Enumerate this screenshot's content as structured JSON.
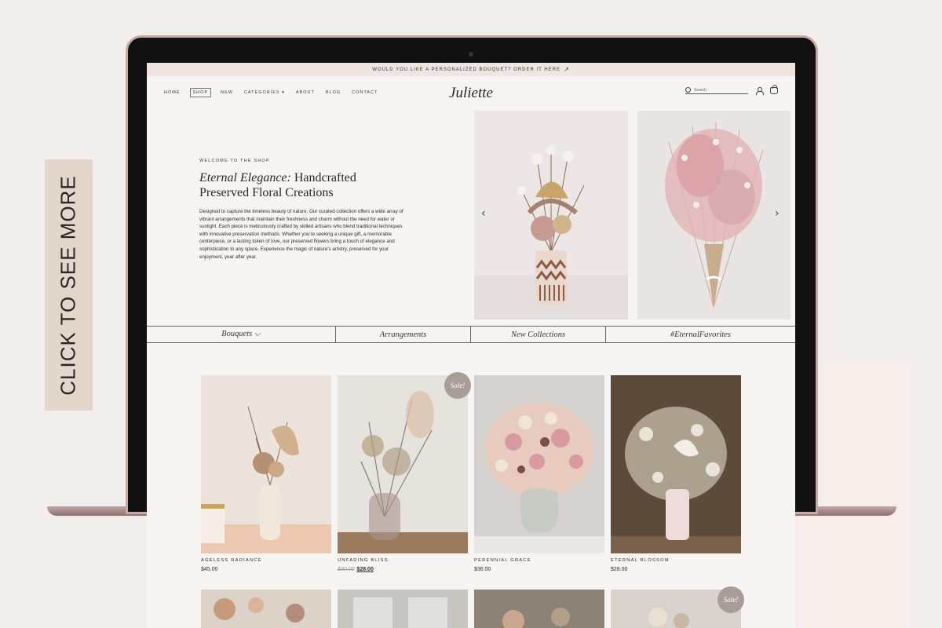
{
  "side_tab": {
    "label": "CLICK TO SEE MORE"
  },
  "announcement": {
    "text": "WOULD YOU LIKE A PERSONALIZED BOUQUET? ORDER IT HERE",
    "arrow": "↗"
  },
  "nav": {
    "links": [
      "HOME",
      "SHOP",
      "NEW",
      "CATEGORIES ▾",
      "ABOUT",
      "BLOG",
      "CONTACT"
    ],
    "active_index": 1,
    "logo": "Juliette",
    "search_placeholder": "Search"
  },
  "hero": {
    "eyebrow": "WELCOME TO THE SHOP",
    "title_italic": "Eternal Elegance:",
    "title_rest": " Handcrafted Preserved Floral Creations",
    "body": "Designed to capture the timeless beauty of nature. Our curated collection offers a wide array of vibrant arrangements that maintain their freshness and charm without the need for water or sunlight. Each piece is meticulously crafted by skilled artisans who blend traditional techniques with innovative preservation methods. Whether you're seeking a unique gift, a memorable centerpiece, or a lasting token of love, our preserved flowers bring a touch of elegance and sophistication to any space. Experience the magic of nature's artistry, preserved for your enjoyment, year after year.",
    "prev": "‹",
    "next": "›"
  },
  "categories": [
    "Bouquets ⌵",
    "Arrangements",
    "New Collections",
    "#EternalFavorites"
  ],
  "products": [
    {
      "name": "AGELESS RADIANCE",
      "price": "$45.00",
      "old_price": "",
      "sale": false
    },
    {
      "name": "UNFADING BLISS",
      "price": "$28.00",
      "old_price": "$30.00",
      "sale": true,
      "badge": "Sale!"
    },
    {
      "name": "PERENNIAL GRACE",
      "price": "$36.00",
      "old_price": "",
      "sale": false
    },
    {
      "name": "ETERNAL BLOSSOM",
      "price": "$28.00",
      "old_price": "",
      "sale": false
    }
  ],
  "row2_badge": "Sale!",
  "colors": {
    "accent": "#a99d97",
    "bg": "#f7f5f3",
    "side_tab": "#e3d7cc"
  }
}
